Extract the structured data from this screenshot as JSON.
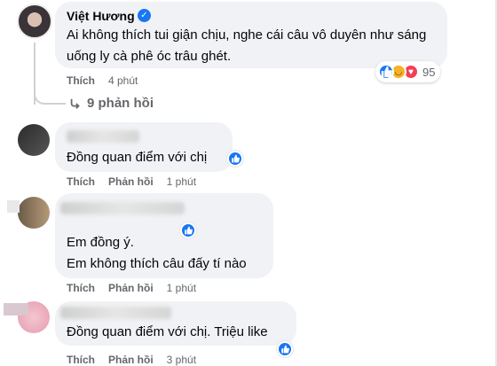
{
  "main_comment": {
    "author": "Việt Hương",
    "text": "Ai không thích tui giận chịu, nghe cái câu vô duyên như sáng uống ly cà phê óc trâu ghét.",
    "reaction_count": "95",
    "like_label": "Thích",
    "time": "4 phút",
    "replies_label": "9 phản hồi"
  },
  "replies": [
    {
      "text": "Đồng quan điểm với chị",
      "like_label": "Thích",
      "reply_label": "Phản hồi",
      "time": "1 phút"
    },
    {
      "text_line1": "Em đồng ý.",
      "text_line2": "Em không thích câu đấy tí nào",
      "like_label": "Thích",
      "reply_label": "Phản hồi",
      "time": "1 phút"
    },
    {
      "text": "Đồng quan điểm với chị. Triệu like",
      "like_label": "Thích",
      "reply_label": "Phản hồi",
      "time": "3 phút"
    }
  ],
  "colors": {
    "accent": "#1877f2",
    "bubble": "#f0f2f5",
    "muted": "#65676b"
  },
  "icons": [
    "verified-badge-icon",
    "like-icon",
    "haha-icon",
    "love-icon",
    "reply-arrow-icon"
  ]
}
